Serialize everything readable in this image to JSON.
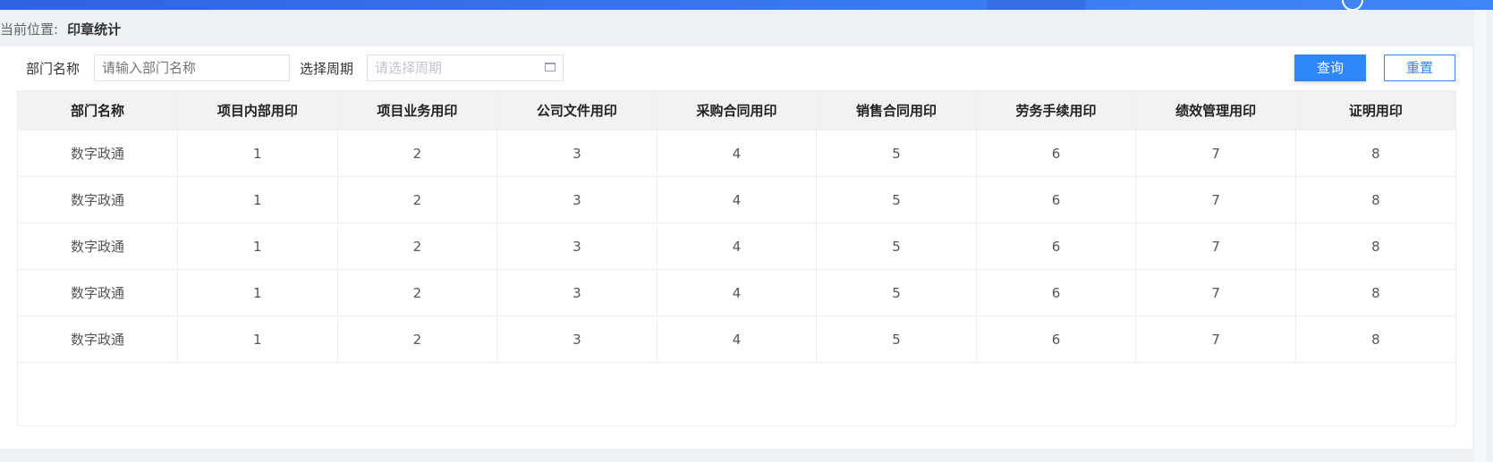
{
  "breadcrumb": {
    "prefix": "当前位置:",
    "current": "印章统计"
  },
  "filters": {
    "dept_label": "部门名称",
    "dept_placeholder": "请输入部门名称",
    "period_label": "选择周期",
    "period_placeholder": "请选择周期"
  },
  "buttons": {
    "query": "查询",
    "reset": "重置"
  },
  "table": {
    "headers": [
      "部门名称",
      "项目内部用印",
      "项目业务用印",
      "公司文件用印",
      "采购合同用印",
      "销售合同用印",
      "劳务手续用印",
      "绩效管理用印",
      "证明用印"
    ],
    "rows": [
      [
        "数字政通",
        "1",
        "2",
        "3",
        "4",
        "5",
        "6",
        "7",
        "8"
      ],
      [
        "数字政通",
        "1",
        "2",
        "3",
        "4",
        "5",
        "6",
        "7",
        "8"
      ],
      [
        "数字政通",
        "1",
        "2",
        "3",
        "4",
        "5",
        "6",
        "7",
        "8"
      ],
      [
        "数字政通",
        "1",
        "2",
        "3",
        "4",
        "5",
        "6",
        "7",
        "8"
      ],
      [
        "数字政通",
        "1",
        "2",
        "3",
        "4",
        "5",
        "6",
        "7",
        "8"
      ]
    ]
  },
  "colors": {
    "accent": "#2f86f6",
    "header_bar": "#3a7bf0"
  },
  "icons": {
    "calendar": "calendar-icon",
    "user": "user-icon"
  }
}
